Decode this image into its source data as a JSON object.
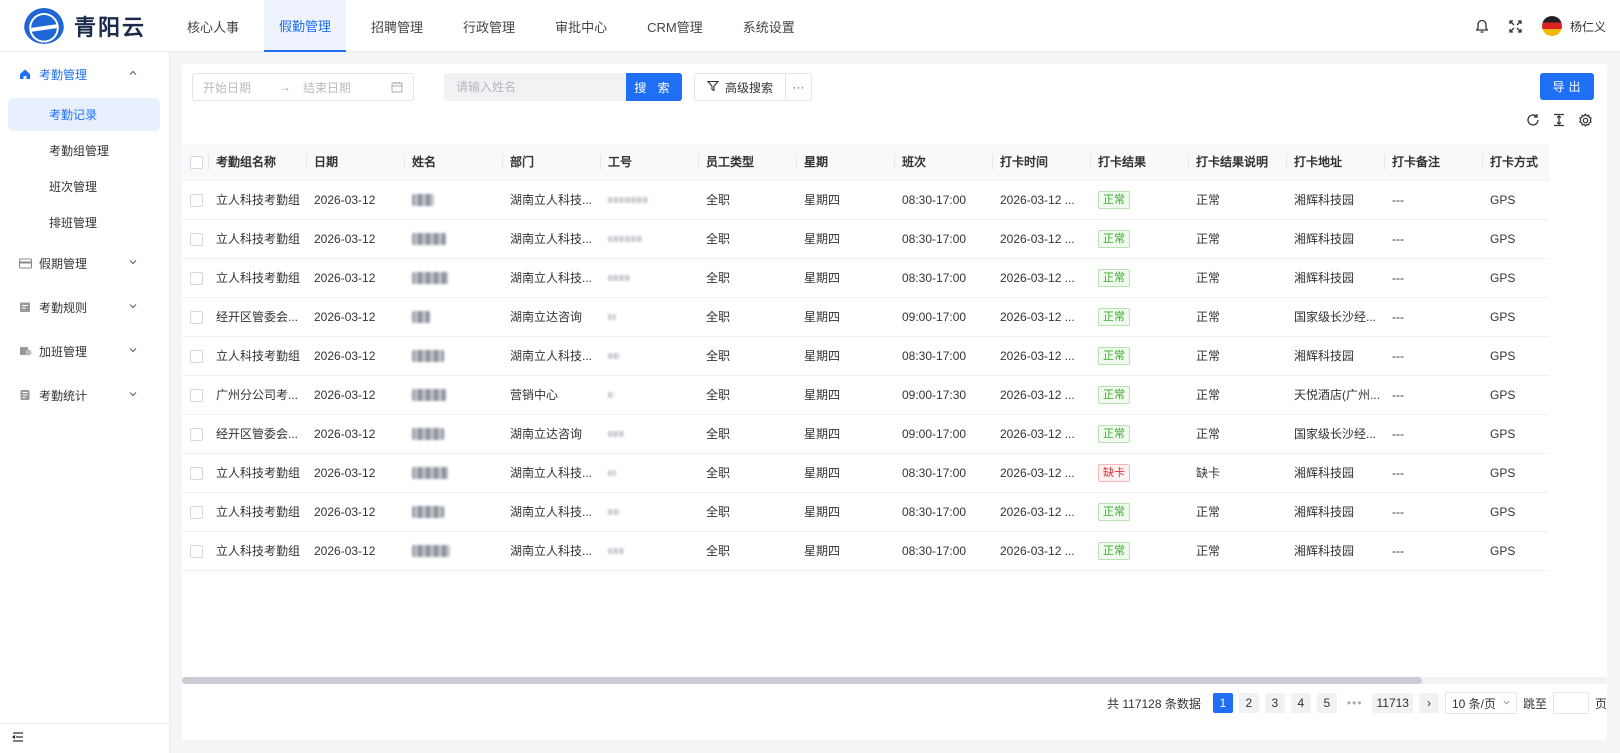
{
  "app": {
    "logo_text": "青阳云"
  },
  "nav": {
    "items": [
      {
        "label": "核心人事"
      },
      {
        "label": "假勤管理",
        "active": true
      },
      {
        "label": "招聘管理"
      },
      {
        "label": "行政管理"
      },
      {
        "label": "审批中心"
      },
      {
        "label": "CRM管理"
      },
      {
        "label": "系统设置"
      }
    ]
  },
  "user": {
    "name": "杨仁义"
  },
  "sidebar": {
    "groups": [
      {
        "label": "考勤管理",
        "icon": "home-icon",
        "open": true
      },
      {
        "label": "假期管理",
        "icon": "card-icon"
      },
      {
        "label": "考勤规则",
        "icon": "rules-icon"
      },
      {
        "label": "加班管理",
        "icon": "overtime-icon"
      },
      {
        "label": "考勤统计",
        "icon": "stats-icon"
      }
    ],
    "sub_items": [
      {
        "label": "考勤记录",
        "active": true
      },
      {
        "label": "考勤组管理"
      },
      {
        "label": "班次管理"
      },
      {
        "label": "排班管理"
      }
    ]
  },
  "filters": {
    "start_placeholder": "开始日期",
    "end_placeholder": "结束日期",
    "name_placeholder": "请输入姓名",
    "search_label": "搜 索",
    "advanced_label": "高级搜索",
    "more_label": "···",
    "export_label": "导出"
  },
  "table": {
    "columns": [
      "考勤组名称",
      "日期",
      "姓名",
      "部门",
      "工号",
      "员工类型",
      "星期",
      "班次",
      "打卡时间",
      "打卡结果",
      "打卡结果说明",
      "打卡地址",
      "打卡备注",
      "打卡方式"
    ],
    "rows": [
      {
        "group": "立人科技考勤组",
        "date": "2026-03-12",
        "dept": "湖南立人科技...",
        "type": "全职",
        "weekday": "星期四",
        "shift": "08:30-17:00",
        "punch": "2026-03-12 ...",
        "result": "正常",
        "result_kind": "ok",
        "desc": "正常",
        "addr": "湘辉科技园",
        "note": "---",
        "method": "GPS"
      },
      {
        "group": "立人科技考勤组",
        "date": "2026-03-12",
        "dept": "湖南立人科技...",
        "type": "全职",
        "weekday": "星期四",
        "shift": "08:30-17:00",
        "punch": "2026-03-12 ...",
        "result": "正常",
        "result_kind": "ok",
        "desc": "正常",
        "addr": "湘辉科技园",
        "note": "---",
        "method": "GPS"
      },
      {
        "group": "立人科技考勤组",
        "date": "2026-03-12",
        "dept": "湖南立人科技...",
        "type": "全职",
        "weekday": "星期四",
        "shift": "08:30-17:00",
        "punch": "2026-03-12 ...",
        "result": "正常",
        "result_kind": "ok",
        "desc": "正常",
        "addr": "湘辉科技园",
        "note": "---",
        "method": "GPS"
      },
      {
        "group": "经开区管委会...",
        "date": "2026-03-12",
        "dept": "湖南立达咨询",
        "type": "全职",
        "weekday": "星期四",
        "shift": "09:00-17:00",
        "punch": "2026-03-12 ...",
        "result": "正常",
        "result_kind": "ok",
        "desc": "正常",
        "addr": "国家级长沙经...",
        "note": "---",
        "method": "GPS"
      },
      {
        "group": "立人科技考勤组",
        "date": "2026-03-12",
        "dept": "湖南立人科技...",
        "type": "全职",
        "weekday": "星期四",
        "shift": "08:30-17:00",
        "punch": "2026-03-12 ...",
        "result": "正常",
        "result_kind": "ok",
        "desc": "正常",
        "addr": "湘辉科技园",
        "note": "---",
        "method": "GPS"
      },
      {
        "group": "广州分公司考...",
        "date": "2026-03-12",
        "dept": "营销中心",
        "type": "全职",
        "weekday": "星期四",
        "shift": "09:00-17:30",
        "punch": "2026-03-12 ...",
        "result": "正常",
        "result_kind": "ok",
        "desc": "正常",
        "addr": "天悦酒店(广州...",
        "note": "---",
        "method": "GPS"
      },
      {
        "group": "经开区管委会...",
        "date": "2026-03-12",
        "dept": "湖南立达咨询",
        "type": "全职",
        "weekday": "星期四",
        "shift": "09:00-17:00",
        "punch": "2026-03-12 ...",
        "result": "正常",
        "result_kind": "ok",
        "desc": "正常",
        "addr": "国家级长沙经...",
        "note": "---",
        "method": "GPS"
      },
      {
        "group": "立人科技考勤组",
        "date": "2026-03-12",
        "dept": "湖南立人科技...",
        "type": "全职",
        "weekday": "星期四",
        "shift": "08:30-17:00",
        "punch": "2026-03-12 ...",
        "result": "缺卡",
        "result_kind": "miss",
        "desc": "缺卡",
        "addr": "湘辉科技园",
        "note": "---",
        "method": "GPS"
      },
      {
        "group": "立人科技考勤组",
        "date": "2026-03-12",
        "dept": "湖南立人科技...",
        "type": "全职",
        "weekday": "星期四",
        "shift": "08:30-17:00",
        "punch": "2026-03-12 ...",
        "result": "正常",
        "result_kind": "ok",
        "desc": "正常",
        "addr": "湘辉科技园",
        "note": "---",
        "method": "GPS"
      },
      {
        "group": "立人科技考勤组",
        "date": "2026-03-12",
        "dept": "湖南立人科技...",
        "type": "全职",
        "weekday": "星期四",
        "shift": "08:30-17:00",
        "punch": "2026-03-12 ...",
        "result": "正常",
        "result_kind": "ok",
        "desc": "正常",
        "addr": "湘辉科技园",
        "note": "---",
        "method": "GPS"
      }
    ]
  },
  "pagination": {
    "total_text": "共 117128 条数据",
    "pages": [
      "1",
      "2",
      "3",
      "4",
      "5"
    ],
    "ellipsis": "•••",
    "last_page": "11713",
    "next": "›",
    "page_size": "10 条/页",
    "jump_label": "跳至",
    "page_suffix": "页"
  },
  "colors": {
    "accent": "#1e6ff5",
    "ok": "#3cab2e",
    "miss": "#e0343b"
  }
}
